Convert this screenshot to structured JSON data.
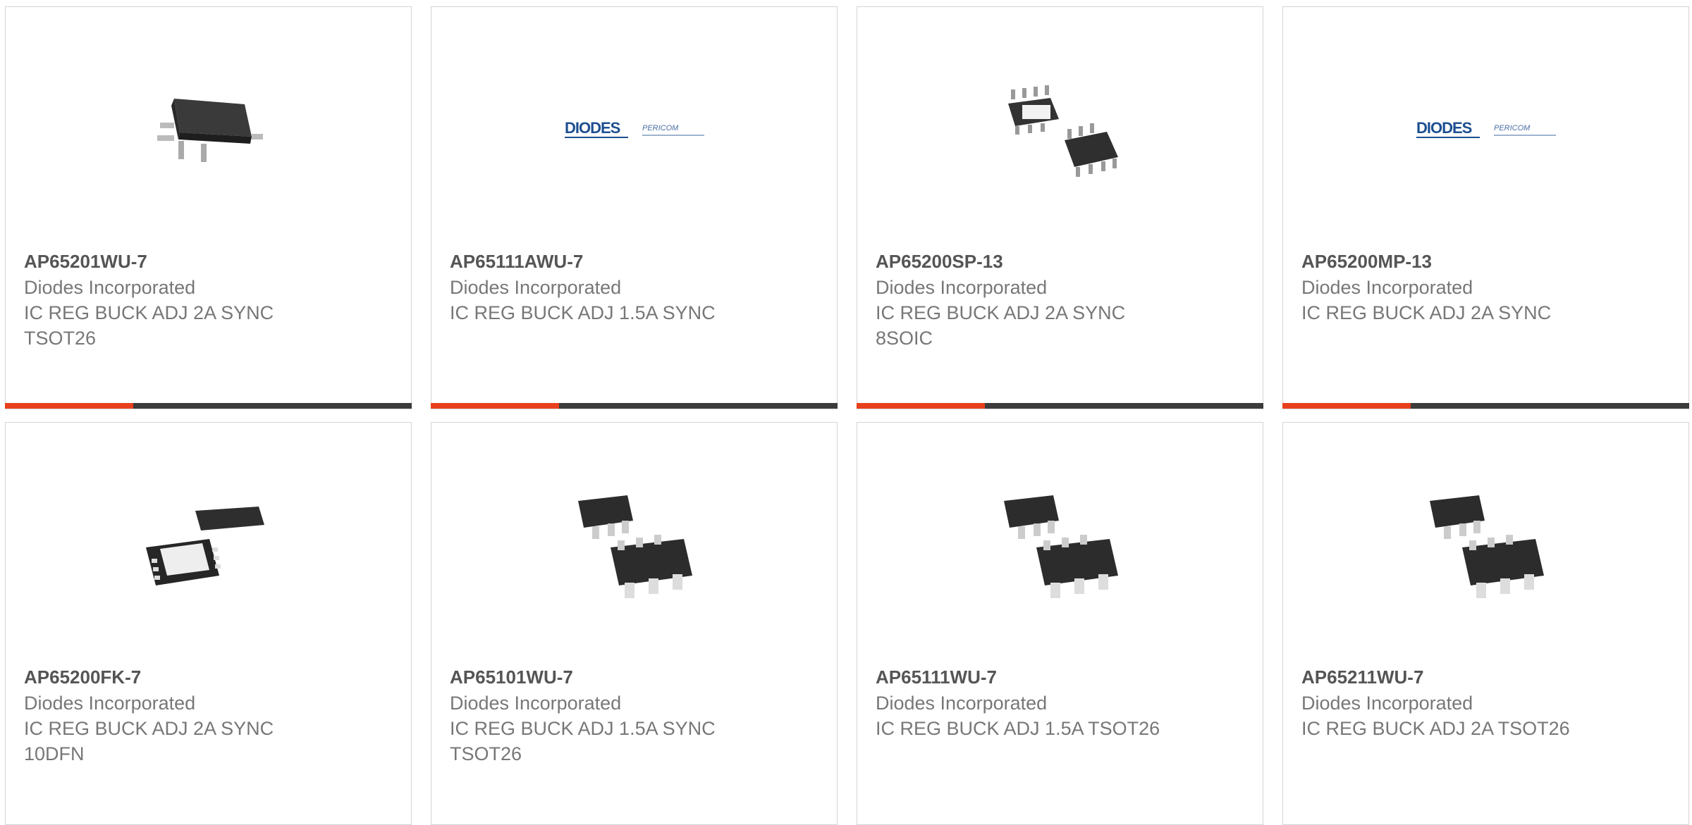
{
  "colors": {
    "accent": "#e8401c",
    "bar": "#3b3b3b",
    "text": "#777777",
    "title": "#555555"
  },
  "products": [
    {
      "part_number": "AP65201WU-7",
      "manufacturer": "Diodes Incorporated",
      "description": "IC REG BUCK ADJ 2A SYNC TSOT26",
      "image": "tsot26-package-icon"
    },
    {
      "part_number": "AP65111AWU-7",
      "manufacturer": "Diodes Incorporated",
      "description": "IC REG BUCK ADJ 1.5A SYNC",
      "image": "diodes-pericom-logo"
    },
    {
      "part_number": "AP65200SP-13",
      "manufacturer": "Diodes Incorporated",
      "description": "IC REG BUCK ADJ 2A SYNC 8SOIC",
      "image": "8soic-package-icon"
    },
    {
      "part_number": "AP65200MP-13",
      "manufacturer": "Diodes Incorporated",
      "description": "IC REG BUCK ADJ 2A SYNC",
      "image": "diodes-pericom-logo"
    },
    {
      "part_number": "AP65200FK-7",
      "manufacturer": "Diodes Incorporated",
      "description": "IC REG BUCK ADJ 2A SYNC 10DFN",
      "image": "10dfn-package-icon"
    },
    {
      "part_number": "AP65101WU-7",
      "manufacturer": "Diodes Incorporated",
      "description": "IC REG BUCK ADJ 1.5A SYNC TSOT26",
      "image": "sot-package-icon"
    },
    {
      "part_number": "AP65111WU-7",
      "manufacturer": "Diodes Incorporated",
      "description": "IC REG BUCK ADJ 1.5A TSOT26",
      "image": "sot-package-icon"
    },
    {
      "part_number": "AP65211WU-7",
      "manufacturer": "Diodes Incorporated",
      "description": "IC REG BUCK ADJ 2A TSOT26",
      "image": "sot-package-icon"
    }
  ]
}
